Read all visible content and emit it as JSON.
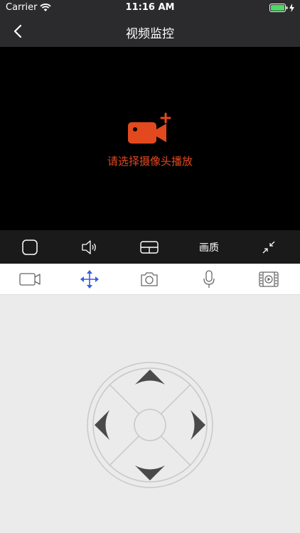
{
  "status_bar": {
    "carrier": "Carrier",
    "time": "11:16 AM"
  },
  "nav": {
    "title": "视频监控"
  },
  "video": {
    "hint": "请选择摄像头播放",
    "accent_color": "#e2491e"
  },
  "controls": {
    "quality_label": "画质"
  },
  "tabs": {
    "items": [
      "record",
      "ptz",
      "snapshot",
      "microphone",
      "playback"
    ],
    "active": "ptz",
    "active_color": "#3b5bdb"
  }
}
